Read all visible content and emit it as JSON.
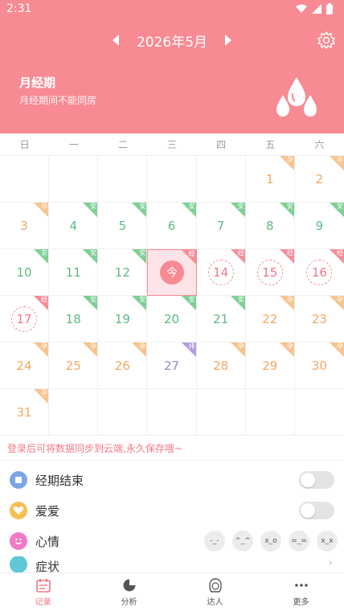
{
  "status": {
    "time": "2:31"
  },
  "header": {
    "month": "2026年5月",
    "period_title": "月经期",
    "period_sub": "月经期间不能同房"
  },
  "weekdays": [
    "日",
    "一",
    "二",
    "三",
    "四",
    "五",
    "六"
  ],
  "calendar": [
    {
      "day": "",
      "color": "",
      "tag": "",
      "tagcolor": ""
    },
    {
      "day": "",
      "color": "",
      "tag": "",
      "tagcolor": ""
    },
    {
      "day": "",
      "color": "",
      "tag": "",
      "tagcolor": ""
    },
    {
      "day": "",
      "color": "",
      "tag": "",
      "tagcolor": ""
    },
    {
      "day": "",
      "color": "",
      "tag": "",
      "tagcolor": ""
    },
    {
      "day": "1",
      "color": "#f3a862",
      "tag": "孕",
      "tagcolor": "#f8c48e"
    },
    {
      "day": "2",
      "color": "#f3a862",
      "tag": "孕",
      "tagcolor": "#f8c48e"
    },
    {
      "day": "3",
      "color": "#f3a862",
      "tag": "孕",
      "tagcolor": "#f8c48e"
    },
    {
      "day": "4",
      "color": "#5dbb84",
      "tag": "安",
      "tagcolor": "#7fcf97"
    },
    {
      "day": "5",
      "color": "#5dbb84",
      "tag": "安",
      "tagcolor": "#7fcf97"
    },
    {
      "day": "6",
      "color": "#5dbb84",
      "tag": "安",
      "tagcolor": "#7fcf97"
    },
    {
      "day": "7",
      "color": "#5dbb84",
      "tag": "安",
      "tagcolor": "#7fcf97"
    },
    {
      "day": "8",
      "color": "#5dbb84",
      "tag": "安",
      "tagcolor": "#7fcf97"
    },
    {
      "day": "9",
      "color": "#5dbb84",
      "tag": "安",
      "tagcolor": "#7fcf97"
    },
    {
      "day": "10",
      "color": "#5dbb84",
      "tag": "安",
      "tagcolor": "#7fcf97"
    },
    {
      "day": "11",
      "color": "#5dbb84",
      "tag": "安",
      "tagcolor": "#7fcf97"
    },
    {
      "day": "12",
      "color": "#5dbb84",
      "tag": "安",
      "tagcolor": "#7fcf97"
    },
    {
      "day": "今",
      "color": "#ffffff",
      "tag": "经",
      "tagcolor": "#f58e98",
      "today": true
    },
    {
      "day": "14",
      "color": "#f0788a",
      "tag": "经",
      "tagcolor": "#f58e98",
      "circle": true
    },
    {
      "day": "15",
      "color": "#f0788a",
      "tag": "经",
      "tagcolor": "#f58e98",
      "circle": true
    },
    {
      "day": "16",
      "color": "#f0788a",
      "tag": "经",
      "tagcolor": "#f58e98",
      "circle": true
    },
    {
      "day": "17",
      "color": "#f0788a",
      "tag": "经",
      "tagcolor": "#f58e98",
      "circle": true
    },
    {
      "day": "18",
      "color": "#5dbb84",
      "tag": "安",
      "tagcolor": "#7fcf97"
    },
    {
      "day": "19",
      "color": "#5dbb84",
      "tag": "安",
      "tagcolor": "#7fcf97"
    },
    {
      "day": "20",
      "color": "#5dbb84",
      "tag": "安",
      "tagcolor": "#7fcf97"
    },
    {
      "day": "21",
      "color": "#5dbb84",
      "tag": "安",
      "tagcolor": "#7fcf97"
    },
    {
      "day": "22",
      "color": "#f3a862",
      "tag": "孕",
      "tagcolor": "#f8c48e"
    },
    {
      "day": "23",
      "color": "#f3a862",
      "tag": "孕",
      "tagcolor": "#f8c48e"
    },
    {
      "day": "24",
      "color": "#f3a862",
      "tag": "孕",
      "tagcolor": "#f8c48e"
    },
    {
      "day": "25",
      "color": "#f3a862",
      "tag": "孕",
      "tagcolor": "#f8c48e"
    },
    {
      "day": "26",
      "color": "#f3a862",
      "tag": "孕",
      "tagcolor": "#f8c48e"
    },
    {
      "day": "27",
      "color": "#9b86cf",
      "tag": "排",
      "tagcolor": "#b29ee0"
    },
    {
      "day": "28",
      "color": "#f3a862",
      "tag": "孕",
      "tagcolor": "#f8c48e"
    },
    {
      "day": "29",
      "color": "#f3a862",
      "tag": "孕",
      "tagcolor": "#f8c48e"
    },
    {
      "day": "30",
      "color": "#f3a862",
      "tag": "孕",
      "tagcolor": "#f8c48e"
    },
    {
      "day": "31",
      "color": "#f3a862",
      "tag": "孕",
      "tagcolor": "#f8c48e"
    },
    {
      "day": "",
      "color": "",
      "tag": "",
      "tagcolor": ""
    },
    {
      "day": "",
      "color": "",
      "tag": "",
      "tagcolor": ""
    },
    {
      "day": "",
      "color": "",
      "tag": "",
      "tagcolor": ""
    },
    {
      "day": "",
      "color": "",
      "tag": "",
      "tagcolor": ""
    },
    {
      "day": "",
      "color": "",
      "tag": "",
      "tagcolor": ""
    },
    {
      "day": "",
      "color": "",
      "tag": "",
      "tagcolor": ""
    }
  ],
  "login_tip": "登录后可将数据同步到云端,永久保存哦~",
  "records": {
    "period_end": "经期结束",
    "love": "爱爱",
    "mood": "心情",
    "symptom": "症状"
  },
  "moods": [
    "-_-",
    "^_^",
    "x_o",
    "=_=",
    "x_x"
  ],
  "tabs": [
    {
      "label": "记录",
      "icon": "calendar-icon",
      "active": true
    },
    {
      "label": "分析",
      "icon": "pie-chart-icon",
      "active": false
    },
    {
      "label": "达人",
      "icon": "woman-face-icon",
      "active": false
    },
    {
      "label": "更多",
      "icon": "more-dots-icon",
      "active": false
    }
  ],
  "colors": {
    "brand": "#f78a93",
    "accent": "#f2727f"
  }
}
